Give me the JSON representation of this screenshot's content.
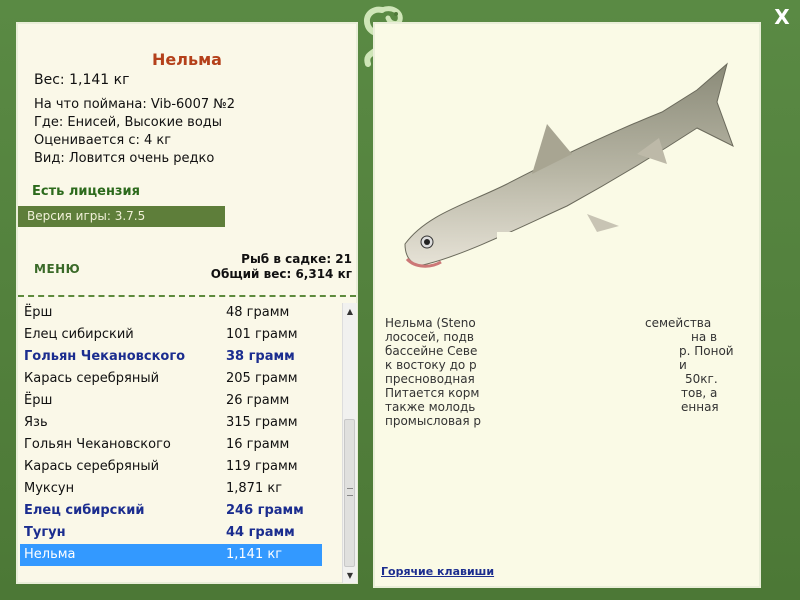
{
  "window": {
    "close_label": "X"
  },
  "catch": {
    "fish_name": "Нельма",
    "weight": "Вес: 1,141 кг",
    "caught_on": "На что поймана: Vib-6007 №2",
    "where": "Где: Енисей, Высокие воды",
    "valued_from": "Оценивается с: 4 кг",
    "kind": "Вид: Ловится очень редко"
  },
  "license_label": "Есть лицензия",
  "version_label": "Версия игры: 3.7.5",
  "menu_label": "МЕНЮ",
  "stats": {
    "fish_count": "Рыб в садке: 21",
    "total_weight": "Общий вес: 6,314 кг"
  },
  "catch_list": [
    {
      "name": "Ёрш",
      "weight": "48 грамм"
    },
    {
      "name": "Елец сибирский",
      "weight": "101 грамм"
    },
    {
      "name": "Гольян Чекановского",
      "weight": "38 грамм"
    },
    {
      "name": "Карась серебряный",
      "weight": "205 грамм"
    },
    {
      "name": "Ёрш",
      "weight": "26 грамм"
    },
    {
      "name": "Язь",
      "weight": "315 грамм"
    },
    {
      "name": "Гольян Чекановского",
      "weight": "16 грамм"
    },
    {
      "name": "Карась серебряный",
      "weight": "119 грамм"
    },
    {
      "name": "Муксун",
      "weight": "1,871 кг"
    },
    {
      "name": "Елец сибирский",
      "weight": "246 грамм"
    },
    {
      "name": "Тугун",
      "weight": "44 грамм"
    },
    {
      "name": "Нельма",
      "weight": "1,141 кг"
    }
  ],
  "description": {
    "line1": "Нельма (Steno",
    "line1b": "семейства",
    "line2": "лососей, подв",
    "line2b": "на в",
    "line3": "бассейне Севе",
    "line3b": "р. Поной",
    "line4": "к востоку до р",
    "line4b": "и",
    "line5": "пресноводная",
    "line5b": "50кг.",
    "line6": "Питается корм",
    "line6b": "тов, а",
    "line7": "также молодь",
    "line7b": "енная",
    "line8": "промысловая р"
  },
  "hotkeys_label": "Горячие клавиши",
  "colors": {
    "frame": "#4f7a3a",
    "panel": "#faf8e8",
    "name": "#b4401a",
    "highlight": "#3399ff",
    "bold_row": "#1b2d8f"
  }
}
